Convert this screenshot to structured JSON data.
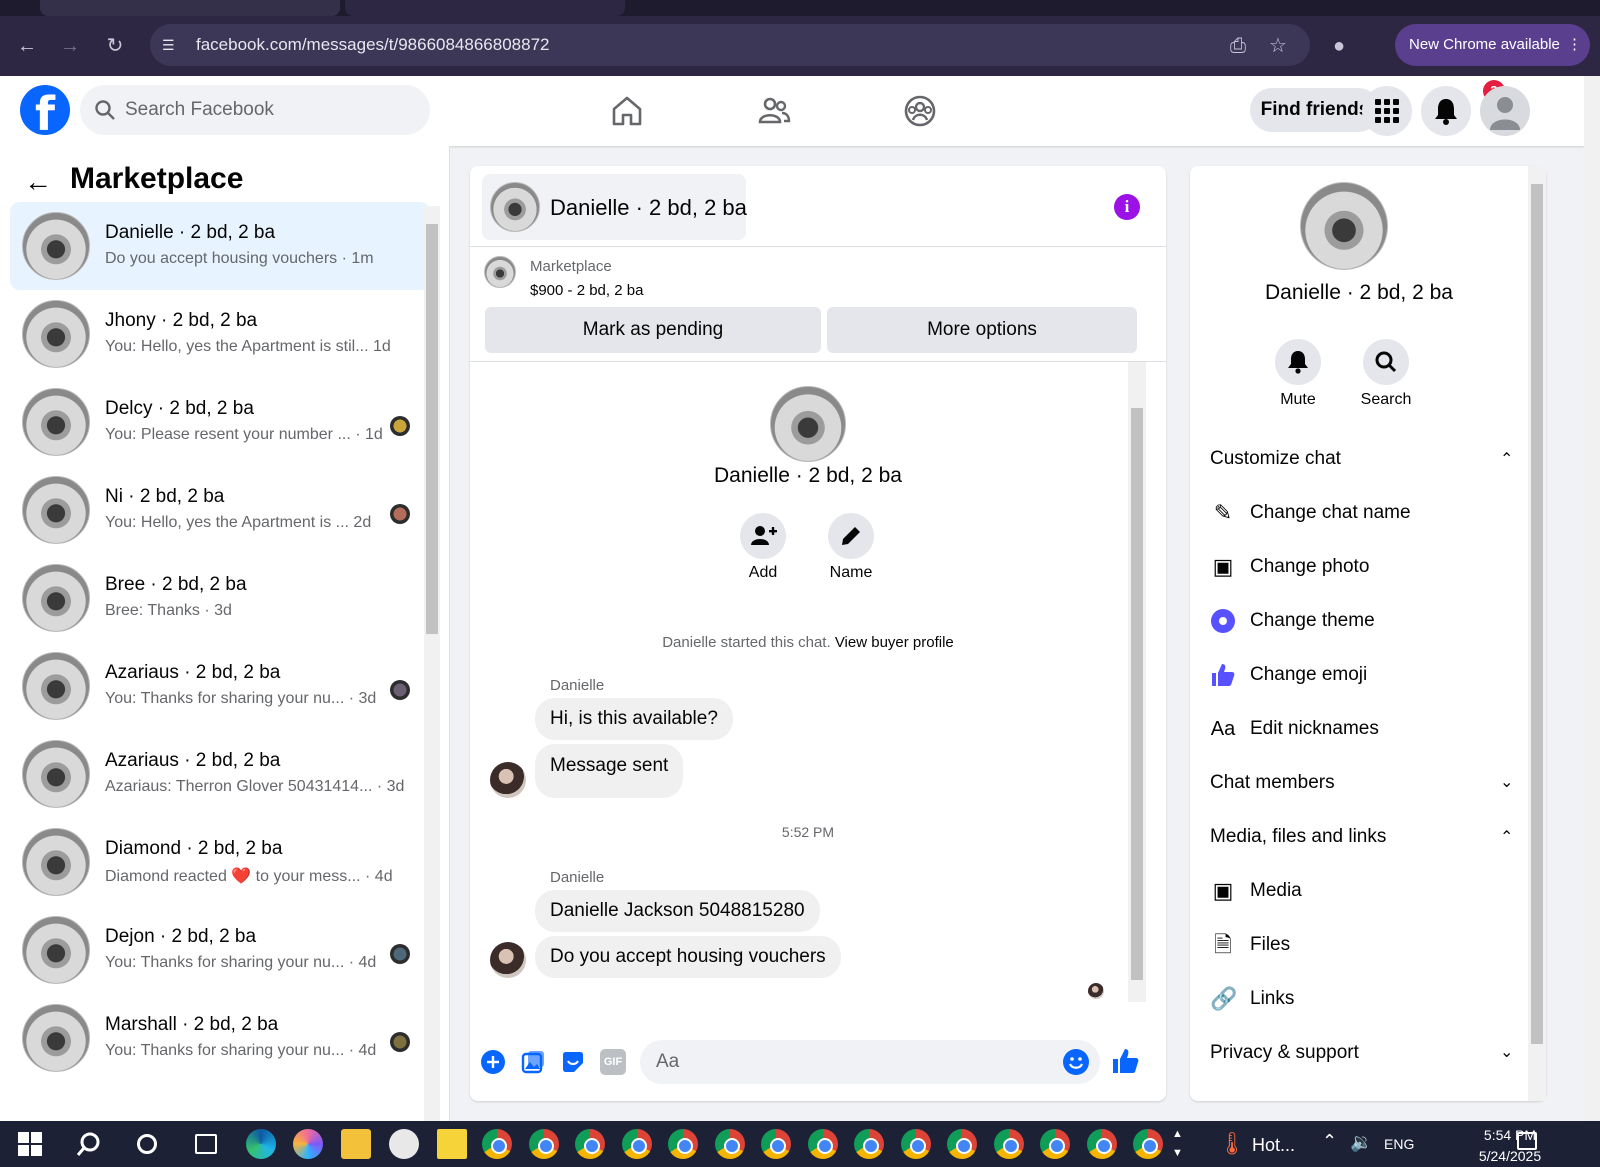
{
  "browser": {
    "url": "facebook.com/messages/t/9866084866808872",
    "new_chrome_label": "New Chrome available"
  },
  "header": {
    "search_placeholder": "Search Facebook",
    "find_friends_label": "Find friends",
    "notification_count": "3"
  },
  "sidebar": {
    "title": "Marketplace",
    "conversations": [
      {
        "name": "Danielle · 2 bd, 2 ba",
        "preview": "Do you accept housing vouchers",
        "time": " · 1m",
        "selected": true
      },
      {
        "name": "Jhony · 2 bd, 2 ba",
        "preview": "You: Hello, yes the Apartment is stil...",
        "time": " 1d"
      },
      {
        "name": "Delcy · 2 bd, 2 ba",
        "preview": "You: Please resent your number ...",
        "time": " · 1d"
      },
      {
        "name": "Ni · 2 bd, 2 ba",
        "preview": "You: Hello, yes the Apartment is ...",
        "time": " 2d"
      },
      {
        "name": "Bree · 2 bd, 2 ba",
        "preview": "Bree: Thanks",
        "time": " · 3d"
      },
      {
        "name": "Azariaus · 2 bd, 2 ba",
        "preview": "You: Thanks for sharing your nu...",
        "time": " · 3d"
      },
      {
        "name": "Azariaus · 2 bd, 2 ba",
        "preview": "Azariaus: Therron Glover 50431414...",
        "time": " · 3d"
      },
      {
        "name": "Diamond · 2 bd, 2 ba",
        "preview": "Diamond reacted ❤️ to your mess...",
        "time": " · 4d"
      },
      {
        "name": "Dejon · 2 bd, 2 ba",
        "preview": "You: Thanks for sharing your nu...",
        "time": " · 4d"
      },
      {
        "name": "Marshall · 2 bd, 2 ba",
        "preview": "You: Thanks for sharing your nu...",
        "time": " · 4d"
      }
    ]
  },
  "chat": {
    "title": "Danielle · 2 bd, 2 ba",
    "listing_label": "Marketplace",
    "listing_price": "$900 - 2 bd, 2 ba",
    "mark_pending_label": "Mark as pending",
    "more_options_label": "More options",
    "profile_name": "Danielle · 2 bd, 2 ba",
    "add_label": "Add",
    "name_label": "Name",
    "started_text": "Danielle started this chat.",
    "view_profile_label": "View buyer profile",
    "sender_name": "Danielle",
    "messages_group1": [
      "Hi, is this available?",
      "Message sent"
    ],
    "timestamp": "5:52 PM",
    "sender_name2": "Danielle",
    "messages_group2": [
      "Danielle Jackson 5048815280",
      "Do you accept housing vouchers"
    ],
    "composer_placeholder": "Aa"
  },
  "details": {
    "name": "Danielle · 2 bd, 2 ba",
    "mute_label": "Mute",
    "search_label": "Search",
    "customize_label": "Customize chat",
    "change_chat_name": "Change chat name",
    "change_photo": "Change photo",
    "change_theme": "Change theme",
    "change_emoji": "Change emoji",
    "edit_nicknames": "Edit nicknames",
    "chat_members": "Chat members",
    "media_files_links": "Media, files and links",
    "media": "Media",
    "files": "Files",
    "links": "Links",
    "privacy_support": "Privacy & support"
  },
  "taskbar": {
    "weather": "Hot...",
    "lang": "ENG",
    "time": "5:54 PM",
    "date": "5/24/2025"
  },
  "colors": {
    "accent": "#0866ff",
    "theme": "#5851ff",
    "info": "#9b11e6",
    "selected_row": "#e7f3ff"
  }
}
